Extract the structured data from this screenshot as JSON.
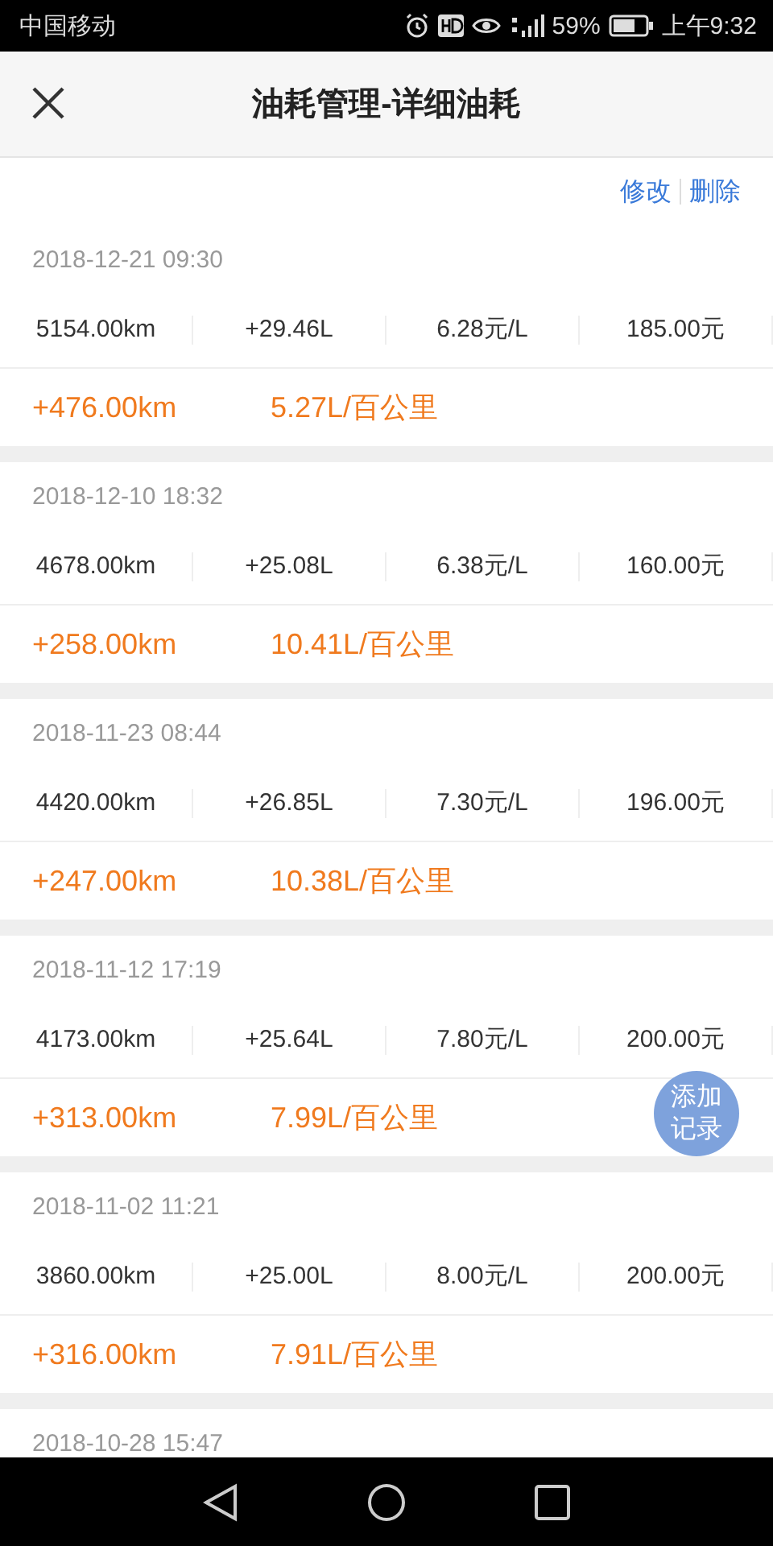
{
  "status_bar": {
    "carrier": "中国移动",
    "battery": "59%",
    "time": "上午9:32"
  },
  "header": {
    "title": "油耗管理-详细油耗"
  },
  "actions": [
    {
      "label": "修改"
    },
    {
      "label": "删除"
    }
  ],
  "records": [
    {
      "date": "2018-12-21 09:30",
      "odometer": "5154.00km",
      "fuel": "+29.46L",
      "price": "6.28元/L",
      "cost": "185.00元",
      "distance": "+476.00km",
      "consumption": "5.27L/百公里"
    },
    {
      "date": "2018-12-10 18:32",
      "odometer": "4678.00km",
      "fuel": "+25.08L",
      "price": "6.38元/L",
      "cost": "160.00元",
      "distance": "+258.00km",
      "consumption": "10.41L/百公里"
    },
    {
      "date": "2018-11-23 08:44",
      "odometer": "4420.00km",
      "fuel": "+26.85L",
      "price": "7.30元/L",
      "cost": "196.00元",
      "distance": "+247.00km",
      "consumption": "10.38L/百公里"
    },
    {
      "date": "2018-11-12 17:19",
      "odometer": "4173.00km",
      "fuel": "+25.64L",
      "price": "7.80元/L",
      "cost": "200.00元",
      "distance": "+313.00km",
      "consumption": "7.99L/百公里"
    },
    {
      "date": "2018-11-02 11:21",
      "odometer": "3860.00km",
      "fuel": "+25.00L",
      "price": "8.00元/L",
      "cost": "200.00元",
      "distance": "+316.00km",
      "consumption": "7.91L/百公里"
    },
    {
      "date": "2018-10-28 15:47"
    }
  ],
  "fab": {
    "label": "添加记录"
  }
}
